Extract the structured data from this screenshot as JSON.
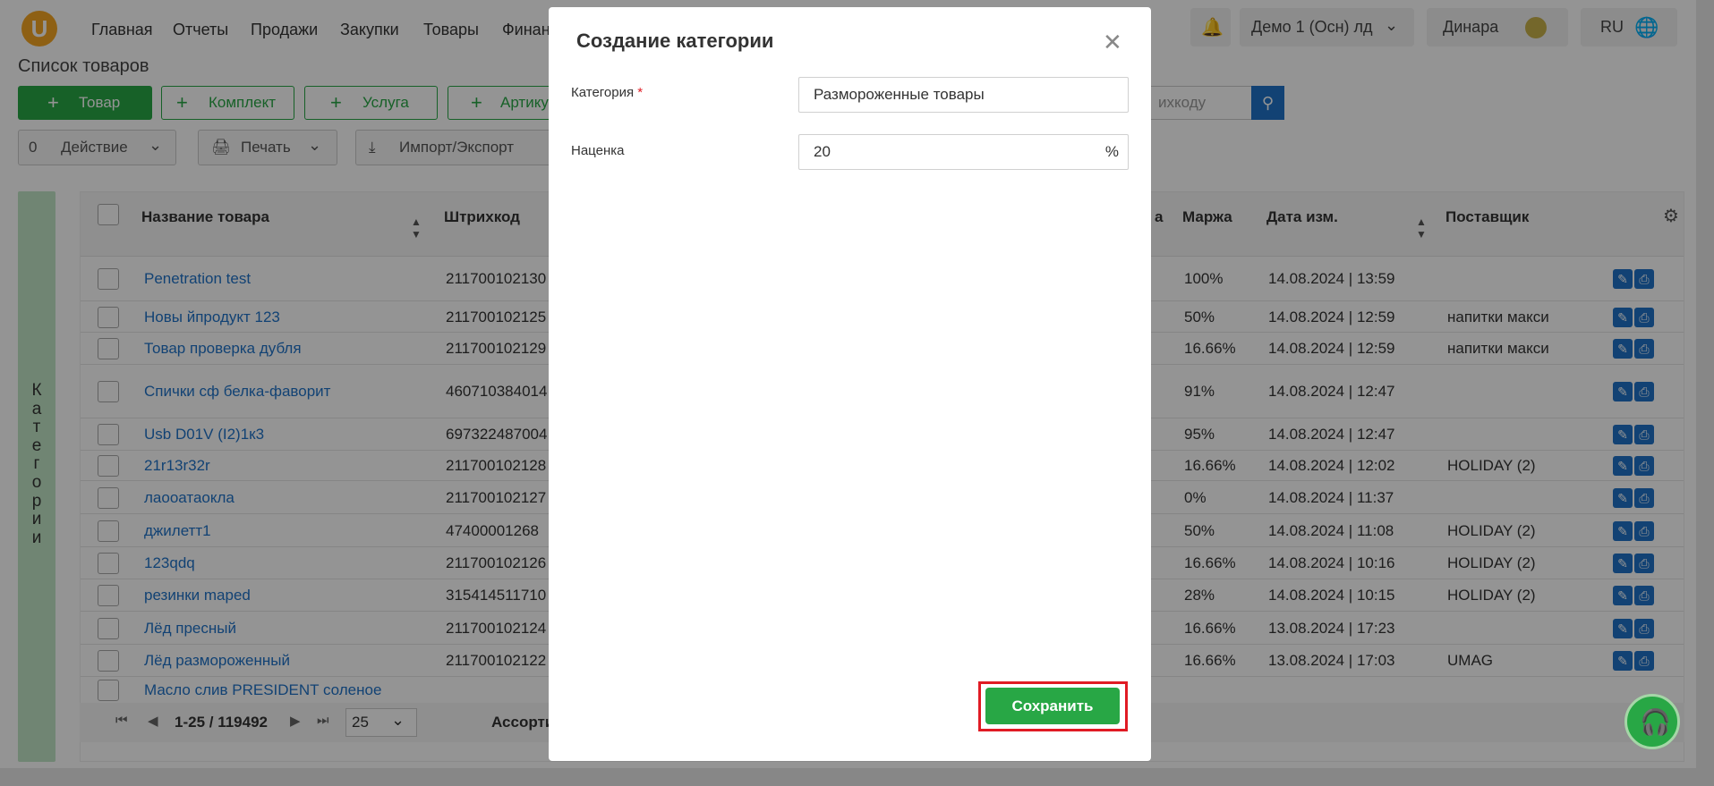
{
  "nav": {
    "logo": "U",
    "items": [
      "Главная",
      "Отчеты",
      "Продажи",
      "Закупки",
      "Товары",
      "Финан"
    ],
    "store": "Демо 1 (Осн) лд",
    "user": "Динара",
    "lang": "RU"
  },
  "page": {
    "title": "Список товаров"
  },
  "toolbar": {
    "add_product": "Товар",
    "add_bundle": "Комплект",
    "add_service": "Услуга",
    "add_article": "Артику",
    "search_placeholder": "ихкоду",
    "selected_count": "0",
    "action": "Действие",
    "print": "Печать",
    "import_export": "Импорт/Экспорт"
  },
  "categories_label": "Категории",
  "table": {
    "headers": [
      "Название товара",
      "Штрихкод",
      "а",
      "Маржа",
      "Дата изм.",
      "Поставщик"
    ],
    "rows": [
      {
        "name": "Penetration test",
        "barcode": "211700102130",
        "margin": "100%",
        "date": "14.08.2024 | 13:59",
        "supplier": ""
      },
      {
        "name": "Новы йпродукт 123",
        "barcode": "211700102125",
        "margin": "50%",
        "date": "14.08.2024 | 12:59",
        "supplier": "напитки макси"
      },
      {
        "name": "Товар проверка дубля",
        "barcode": "211700102129",
        "margin": "16.66%",
        "date": "14.08.2024 | 12:59",
        "supplier": "напитки макси"
      },
      {
        "name": "Спички сф белка-фаворит",
        "barcode": "460710384014",
        "margin": "91%",
        "date": "14.08.2024 | 12:47",
        "supplier": ""
      },
      {
        "name": "Usb D01V (I2)1к3",
        "barcode": "697322487004",
        "margin": "95%",
        "date": "14.08.2024 | 12:47",
        "supplier": ""
      },
      {
        "name": "21r13r32r",
        "barcode": "211700102128",
        "margin": "16.66%",
        "date": "14.08.2024 | 12:02",
        "supplier": "HOLIDAY (2)"
      },
      {
        "name": "лаооатаокла",
        "barcode": "211700102127",
        "margin": "0%",
        "date": "14.08.2024 | 11:37",
        "supplier": ""
      },
      {
        "name": "джилетт1",
        "barcode": "47400001268",
        "margin": "50%",
        "date": "14.08.2024 | 11:08",
        "supplier": "HOLIDAY (2)"
      },
      {
        "name": "123qdq",
        "barcode": "211700102126",
        "margin": "16.66%",
        "date": "14.08.2024 | 10:16",
        "supplier": "HOLIDAY (2)"
      },
      {
        "name": "резинки maped",
        "barcode": "315414511710",
        "margin": "28%",
        "date": "14.08.2024 | 10:15",
        "supplier": "HOLIDAY (2)"
      },
      {
        "name": "Лёд пресный",
        "barcode": "211700102124",
        "margin": "16.66%",
        "date": "13.08.2024 | 17:23",
        "supplier": ""
      },
      {
        "name": "Лёд размороженный",
        "barcode": "211700102122",
        "margin": "16.66%",
        "date": "13.08.2024 | 17:03",
        "supplier": "UMAG"
      },
      {
        "name": "Масло слив PRESIDENT соленое",
        "barcode": "",
        "margin": "",
        "date": "",
        "supplier": ""
      }
    ]
  },
  "pager": {
    "range": "1-25 / 119492",
    "page_size": "25",
    "assortment": "Ассорти"
  },
  "modal": {
    "title": "Создание категории",
    "category_label": "Категория",
    "required_mark": "*",
    "category_value": "Размороженные товары",
    "markup_label": "Наценка",
    "markup_value": "20",
    "markup_unit": "%",
    "save_label": "Сохранить"
  }
}
